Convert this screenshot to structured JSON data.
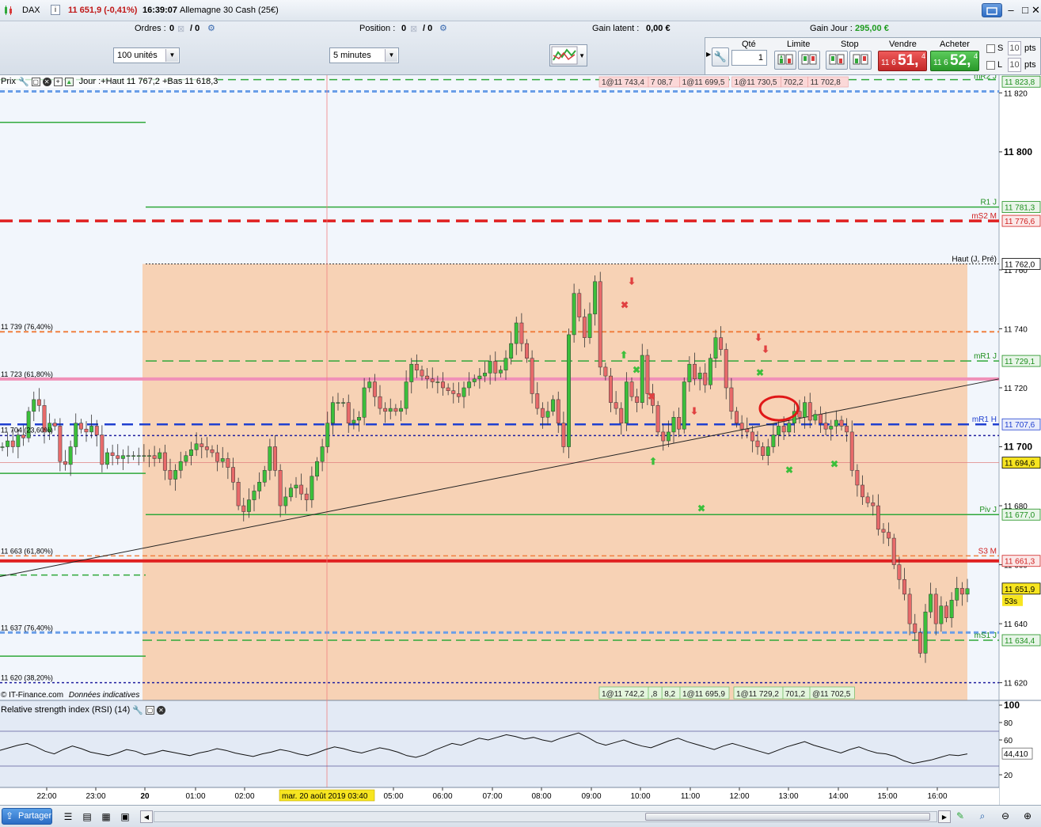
{
  "titlebar": {
    "instrument": "DAX",
    "price_change": "11 651,9 (-0,41%)",
    "time": "16:39:07",
    "market": "Allemagne 30 Cash (25€)"
  },
  "toolbar": {
    "ordres_label": "Ordres :",
    "ordres_a": "0",
    "ordres_b": "/ 0",
    "position_label": "Position :",
    "position_a": "0",
    "position_b": "/ 0",
    "gain_latent_label": "Gain latent :",
    "gain_latent_value": "0,00 €",
    "gain_jour_label": "Gain Jour :",
    "gain_jour_value": "295,00 €",
    "units_select": "100 unités",
    "interval_select": "5 minutes",
    "qty_label": "Qté",
    "qty_value": "1",
    "limite_label": "Limite",
    "stop_label": "Stop",
    "vendre_label": "Vendre",
    "acheter_label": "Acheter",
    "sell_small": "11 6",
    "sell_big": "51,",
    "sell_sup": "4",
    "buy_small": "11 6",
    "buy_big": "52,",
    "buy_sup": "4",
    "s_label": "S",
    "l_label": "L",
    "s_pts": "10",
    "l_pts": "10",
    "pts_label": "pts",
    "colors": {
      "sell": "#d83a3a",
      "buy": "#2fa83a",
      "gain": "#1e9b1e"
    }
  },
  "chart_data": {
    "type": "candlestick",
    "title": "Prix",
    "header_info": "Jour :+Haut 11 767,2 +Bas 11 618,3",
    "ylim": [
      11614,
      11826
    ],
    "price_ticks": [
      {
        "v": 11820,
        "t": "11 820"
      },
      {
        "v": 11800,
        "t": "11 800",
        "bold": true
      },
      {
        "v": 11760,
        "t": "11 760"
      },
      {
        "v": 11740,
        "t": "11 740"
      },
      {
        "v": 11720,
        "t": "11 720"
      },
      {
        "v": 11700,
        "t": "11 700",
        "bold": true
      },
      {
        "v": 11680,
        "t": "11 680"
      },
      {
        "v": 11660,
        "t": "11 660"
      },
      {
        "v": 11640,
        "t": "11 640"
      },
      {
        "v": 11620,
        "t": "11 620"
      }
    ],
    "price_tags": [
      {
        "v": 11823.8,
        "t": "11 823,8",
        "color": "#1e8f1e",
        "bg": "#e8f5e8"
      },
      {
        "v": 11781.3,
        "t": "11 781,3",
        "color": "#1e8f1e",
        "bg": "#e8f5e8"
      },
      {
        "v": 11776.6,
        "t": "11 776,6",
        "color": "#d02020",
        "bg": "#fbe8e8"
      },
      {
        "v": 11762.0,
        "t": "11 762,0",
        "color": "#000000",
        "bg": "#ffffff"
      },
      {
        "v": 11729.1,
        "t": "11 729,1",
        "color": "#1e8f1e",
        "bg": "#e8f5e8"
      },
      {
        "v": 11707.6,
        "t": "11 707,6",
        "color": "#2040d0",
        "bg": "#e8ecfb"
      },
      {
        "v": 11694.6,
        "t": "11 694,6",
        "color": "#000000",
        "bg": "#f7e520"
      },
      {
        "v": 11677.0,
        "t": "11 677,0",
        "color": "#1e8f1e",
        "bg": "#e8f5e8"
      },
      {
        "v": 11661.3,
        "t": "11 661,3",
        "color": "#d02020",
        "bg": "#fbe8e8"
      },
      {
        "v": 11651.9,
        "t": "11 651,9",
        "color": "#000000",
        "bg": "#f7e520"
      },
      {
        "v": 11634.4,
        "t": "11 634,4",
        "color": "#1e8f1e",
        "bg": "#e8f5e8"
      }
    ],
    "countdown": "53s",
    "level_labels": [
      {
        "v": 11824,
        "t": "mR2 J",
        "color": "#1e8f1e"
      },
      {
        "v": 11781.3,
        "t": "R1 J",
        "color": "#1e8f1e"
      },
      {
        "v": 11776.6,
        "t": "mS2 M",
        "color": "#d02020"
      },
      {
        "v": 11762,
        "t": "Haut (J, Pré)",
        "color": "#000000"
      },
      {
        "v": 11729.1,
        "t": "mR1 J",
        "color": "#1e8f1e"
      },
      {
        "v": 11707.6,
        "t": "mR1 H",
        "color": "#2040d0"
      },
      {
        "v": 11677,
        "t": "Piv J",
        "color": "#1e8f1e"
      },
      {
        "v": 11663,
        "t": "S3 M",
        "color": "#d02020"
      },
      {
        "v": 11634.4,
        "t": "mS1 J",
        "color": "#1e8f1e"
      }
    ],
    "fib_labels": [
      {
        "v": 11739,
        "t": "11 739 (76,40%)"
      },
      {
        "v": 11723,
        "t": "11 723 (61,80%)"
      },
      {
        "v": 11704,
        "t": "11 704 (23,60%)"
      },
      {
        "v": 11663,
        "t": "11 663 (61,80%)"
      },
      {
        "v": 11637,
        "t": "11 637 (76,40%)"
      },
      {
        "v": 11620,
        "t": "11 620 (38,20%)"
      }
    ],
    "order_tags_top": [
      "1@11 743,4",
      "7 08,7",
      "1@11 699,5",
      "1@11 730,5",
      "702,2",
      "11 702,8"
    ],
    "order_tags_bottom": [
      "1@11 742,2",
      ",8",
      "8,2",
      "1@11 695,9",
      "1@11 729,2",
      "701,2",
      "@11 702,5"
    ],
    "x_labels": [
      "22:00",
      "23:00",
      "20",
      "01:00",
      "02:00",
      "03:40",
      "05:00",
      "06:00",
      "07:00",
      "08:00",
      "09:00",
      "10:00",
      "11:00",
      "12:00",
      "13:00",
      "14:00",
      "15:00",
      "16:00"
    ],
    "crosshair_label": "mar. 20 août 2019 03:40",
    "copyright": "© IT-Finance.com",
    "disclaimer": "Données indicatives",
    "candles": [
      11700,
      11702,
      11700,
      11704,
      11703,
      11712,
      11716,
      11714,
      11705,
      11708,
      11707,
      11695,
      11694,
      11700,
      11708,
      11706,
      11705,
      11707,
      11704,
      11694,
      11698,
      11697,
      11696,
      11697,
      11697,
      11697,
      11697,
      11697,
      11697,
      11696,
      11698,
      11692,
      11689,
      11692,
      11695,
      11697,
      11699,
      11701,
      11700,
      11699,
      11698,
      11695,
      11696,
      11693,
      11688,
      11680,
      11678,
      11682,
      11685,
      11688,
      11692,
      11700,
      11692,
      11680,
      11683,
      11686,
      11687,
      11684,
      11682,
      11690,
      11695,
      11700,
      11708,
      11715,
      11715,
      11715,
      11708,
      11709,
      11710,
      11720,
      11722,
      11717,
      11713,
      11712,
      11713,
      11712,
      11713,
      11722,
      11728,
      11726,
      11724,
      11723,
      11722,
      11722,
      11720,
      11719,
      11718,
      11717,
      11720,
      11722,
      11723,
      11724,
      11725,
      11729,
      11725,
      11726,
      11730,
      11735,
      11742,
      11735,
      11730,
      11718,
      11713,
      11710,
      11712,
      11716,
      11708,
      11700,
      11738,
      11752,
      11744,
      11737,
      11745,
      11756,
      11727,
      11724,
      11715,
      11713,
      11708,
      11722,
      11717,
      11715,
      11731,
      11718,
      11714,
      11705,
      11702,
      11705,
      11710,
      11706,
      11722,
      11728,
      11723,
      11725,
      11721,
      11730,
      11737,
      11733,
      11720,
      11712,
      11708,
      11706,
      11705,
      11702,
      11700,
      11697,
      11700,
      11704,
      11707,
      11705,
      11708,
      11712,
      11710,
      11715,
      11709,
      11711,
      11708,
      11706,
      11707,
      11709,
      11707,
      11705,
      11692,
      11687,
      11683,
      11681,
      11680,
      11672,
      11671,
      11669,
      11660,
      11655,
      11650,
      11640,
      11637,
      11630,
      11644,
      11650,
      11640,
      11646,
      11642,
      11648,
      11652,
      11650,
      11651.9
    ],
    "trendline": {
      "from": {
        "t": 0,
        "v": 11656
      },
      "to": {
        "t": 1,
        "v": 11723
      }
    },
    "rsi": {
      "title": "Relative strength index (RSI) (14)",
      "ylim": [
        10,
        100
      ],
      "ticks": [
        {
          "v": 100,
          "t": "100"
        },
        {
          "v": 80,
          "t": "80"
        },
        {
          "v": 60,
          "t": "60"
        },
        {
          "v": 20,
          "t": "20"
        }
      ],
      "overbought": 70,
      "oversold": 30,
      "value_label": "44,410",
      "values": [
        48,
        51,
        54,
        56,
        52,
        47,
        44,
        49,
        53,
        50,
        46,
        44,
        42,
        45,
        49,
        47,
        43,
        45,
        48,
        46,
        44,
        42,
        45,
        47,
        50,
        48,
        45,
        43,
        41,
        44,
        46,
        49,
        47,
        44,
        42,
        45,
        49,
        52,
        50,
        47,
        45,
        48,
        51,
        49,
        46,
        42,
        40,
        43,
        48,
        52,
        56,
        54,
        58,
        62,
        60,
        63,
        66,
        64,
        61,
        63,
        60,
        58,
        62,
        65,
        68,
        63,
        57,
        54,
        57,
        60,
        56,
        53,
        51,
        55,
        59,
        62,
        58,
        55,
        52,
        49,
        53,
        56,
        53,
        50,
        47,
        44,
        48,
        52,
        55,
        58,
        54,
        51,
        48,
        45,
        49,
        52,
        48,
        45,
        44,
        41,
        36,
        33,
        35,
        37,
        40,
        43,
        42,
        44
      ]
    }
  },
  "statusbar": {
    "share_label": "Partager"
  }
}
